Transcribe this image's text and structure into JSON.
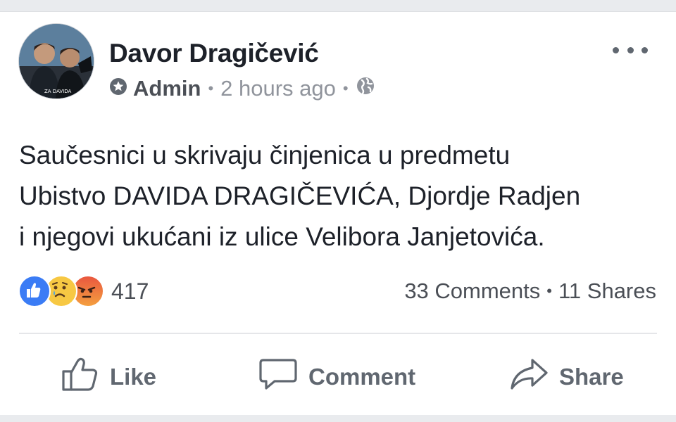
{
  "post": {
    "author": "Davor Dragičević",
    "role": "Admin",
    "timestamp": "2 hours ago",
    "meta_separator": "•",
    "text_lines": [
      "Saučesnici u skrivaju činjenica u predmetu",
      "Ubistvo DAVIDA DRAGIČEVIĆA, Djordje Radjen",
      "i njegovi ukućani iz ulice Velibora Janjetovića."
    ],
    "avatar_text": "ZA DAVIDA"
  },
  "reactions": {
    "count": "417",
    "types": [
      "like-icon",
      "sad-icon",
      "angry-icon"
    ]
  },
  "stats": {
    "comments": "33 Comments",
    "separator": "•",
    "shares": "11 Shares"
  },
  "actions": {
    "like_label": "Like",
    "comment_label": "Comment",
    "share_label": "Share"
  },
  "colors": {
    "like_blue": "#3b7cf5",
    "sad_yellow": "#f7c843",
    "angry_red": "#e9573f",
    "text_gray": "#606770"
  }
}
